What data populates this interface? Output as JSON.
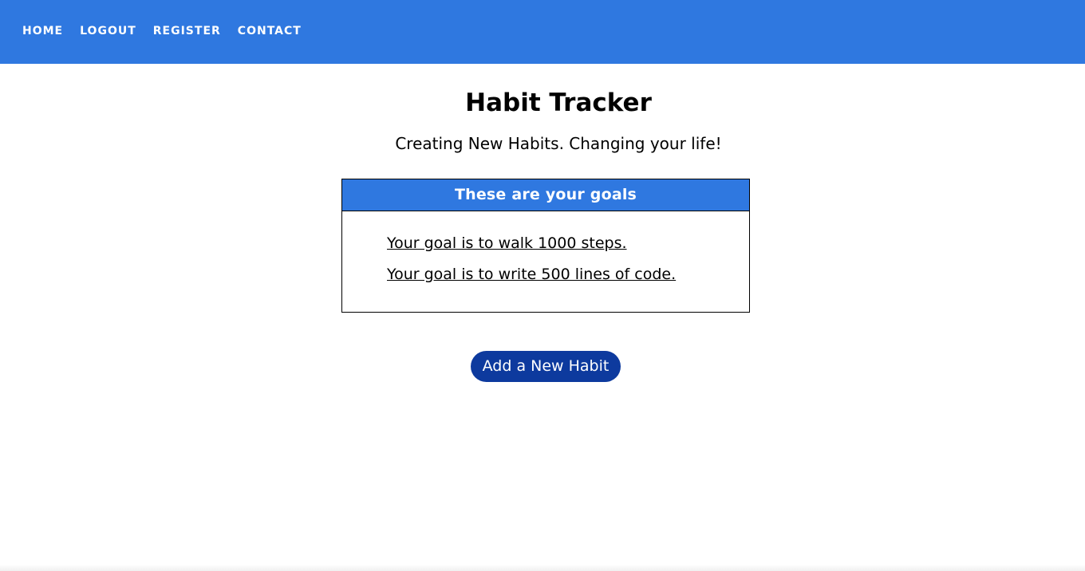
{
  "theme": {
    "nav_bg": "#2f78e0",
    "header_bg": "#2f78e0",
    "button_bg": "#0d3a9e",
    "text": "#000000",
    "nav_text": "#ffffff"
  },
  "nav": {
    "items": [
      {
        "label": "HOME"
      },
      {
        "label": "LOGOUT"
      },
      {
        "label": "REGISTER"
      },
      {
        "label": "CONTACT"
      }
    ]
  },
  "main": {
    "title": "Habit Tracker",
    "tagline": "Creating New Habits. Changing your life!"
  },
  "goals": {
    "header": "These are your goals",
    "items": [
      {
        "text": "Your goal is to walk 1000 steps."
      },
      {
        "text": "Your goal is to write 500 lines of code."
      }
    ]
  },
  "actions": {
    "add_label": "Add a New Habit"
  }
}
